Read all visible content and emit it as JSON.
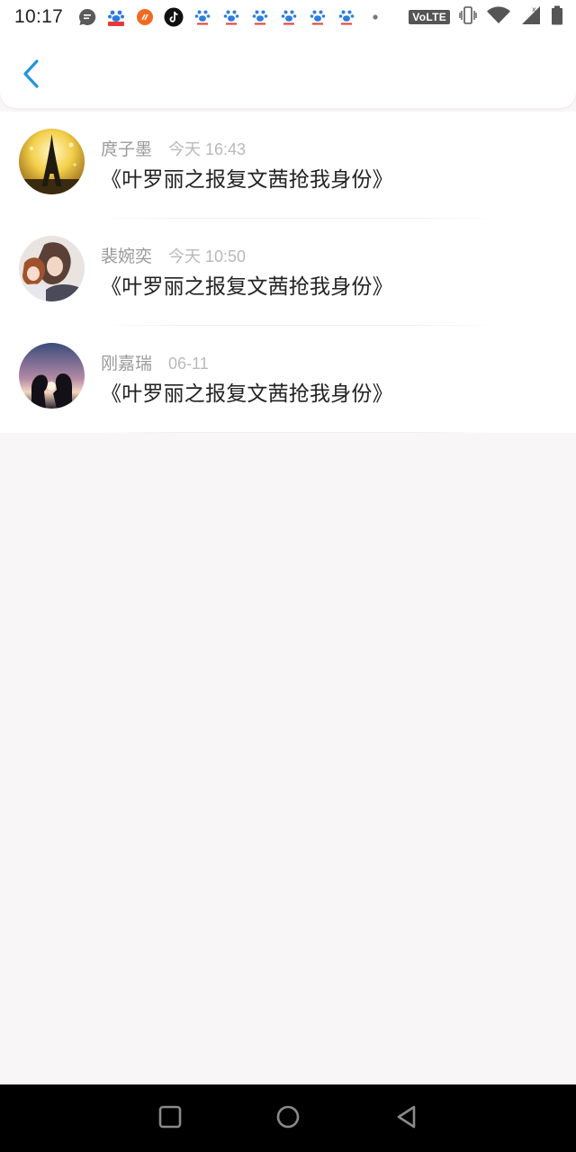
{
  "status_bar": {
    "time": "10:17",
    "network_badge": "VoLTE",
    "notification_icons": [
      "message-icon",
      "baidu-app-icon",
      "weibo-icon",
      "tiktok-icon",
      "baidu-paw-icon",
      "baidu-paw-icon",
      "baidu-paw-icon",
      "baidu-paw-icon",
      "baidu-paw-icon",
      "baidu-paw-icon",
      "dot-icon"
    ],
    "system_icons": [
      "vibrate-icon",
      "wifi-icon",
      "signal-icon",
      "battery-icon"
    ]
  },
  "header": {
    "back_icon": "chevron-left-icon",
    "accent_color": "#2196d6"
  },
  "messages": [
    {
      "name": "庹子墨",
      "time": "今天 16:43",
      "content": "《叶罗丽之报复文茜抢我身份》",
      "avatar": "eiffel-tower-avatar"
    },
    {
      "name": "裴婉奕",
      "time": "今天 10:50",
      "content": "《叶罗丽之报复文茜抢我身份》",
      "avatar": "anime-couple-avatar"
    },
    {
      "name": "刚嘉瑞",
      "time": "06-11",
      "content": "《叶罗丽之报复文茜抢我身份》",
      "avatar": "sunset-couple-avatar"
    }
  ],
  "nav_bar": {
    "icons": [
      "recents-square-icon",
      "home-circle-icon",
      "back-triangle-icon"
    ]
  }
}
